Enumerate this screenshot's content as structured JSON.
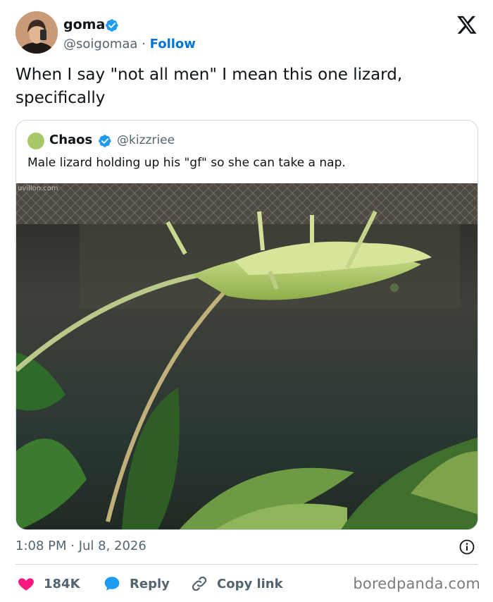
{
  "author": {
    "name": "goma",
    "handle": "@soigomaa",
    "separator": "·",
    "follow_label": "Follow",
    "verified_icon": "verified-badge-icon"
  },
  "tweet": {
    "text": "When I say \"not all men\" I mean this one lizard, specifically"
  },
  "quoted": {
    "name": "Chaos",
    "handle": "@kizzriee",
    "text": "Male lizard holding up his \"gf\" so she can take a nap.",
    "image_watermark": "uvillon.com"
  },
  "meta": {
    "timestamp": "1:08 PM · Jul 8, 2026"
  },
  "actions": {
    "like_count": "184K",
    "reply_label": "Reply",
    "copy_link_label": "Copy link"
  },
  "watermark": "boredpanda.com",
  "colors": {
    "link_blue": "#0074d4",
    "verified_blue": "#1d9bf0",
    "like_red": "#f91880",
    "muted_text": "#536471"
  }
}
